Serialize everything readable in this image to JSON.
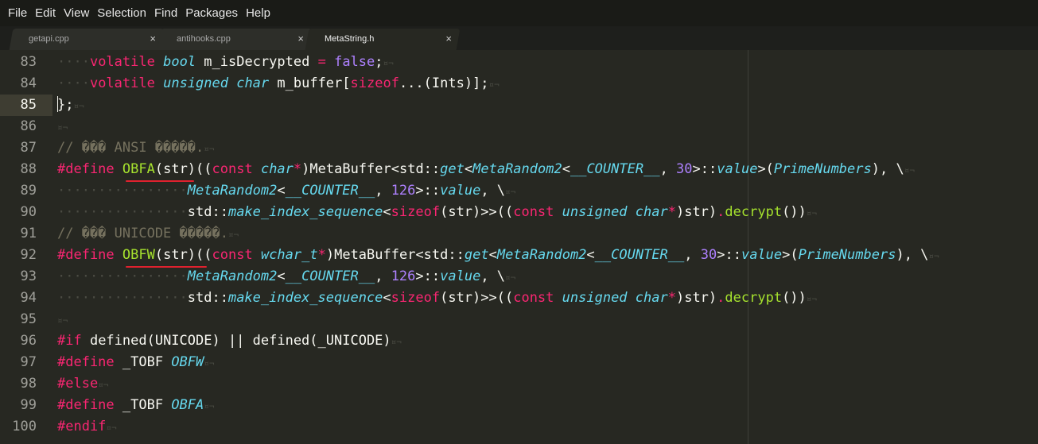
{
  "menu": [
    "File",
    "Edit",
    "View",
    "Selection",
    "Find",
    "Packages",
    "Help"
  ],
  "tabs": [
    {
      "label": "getapi.cpp",
      "close": "×",
      "active": false
    },
    {
      "label": "antihooks.cpp",
      "close": "×",
      "active": false
    },
    {
      "label": "MetaString.h",
      "close": "×",
      "active": true
    }
  ],
  "editor": {
    "lines": [
      {
        "num": "83",
        "tokens": [
          [
            "ws",
            "····"
          ],
          [
            "kw",
            "volatile"
          ],
          [
            "t",
            " "
          ],
          [
            "ty",
            "bool"
          ],
          [
            "t",
            " m_isDecrypted "
          ],
          [
            "kw",
            "="
          ],
          [
            "t",
            " "
          ],
          [
            "nm",
            "false"
          ],
          [
            "t",
            ";"
          ],
          [
            "eol",
            "¤¬"
          ]
        ]
      },
      {
        "num": "84",
        "tokens": [
          [
            "ws",
            "····"
          ],
          [
            "kw",
            "volatile"
          ],
          [
            "t",
            " "
          ],
          [
            "ty",
            "unsigned char"
          ],
          [
            "t",
            " m_buffer["
          ],
          [
            "kw",
            "sizeof"
          ],
          [
            "t",
            "...(Ints)];"
          ],
          [
            "eol",
            "¤¬"
          ]
        ]
      },
      {
        "num": "85",
        "current": true,
        "tokens": [
          [
            "t",
            "};"
          ],
          [
            "eol",
            "¤¬"
          ]
        ]
      },
      {
        "num": "86",
        "tokens": [
          [
            "eol",
            "¤¬"
          ]
        ]
      },
      {
        "num": "87",
        "tokens": [
          [
            "cm",
            "// ��� ANSI �����."
          ],
          [
            "eol",
            "¤¬"
          ]
        ]
      },
      {
        "num": "88",
        "tokens": [
          [
            "kw",
            "#define"
          ],
          [
            "t",
            " "
          ],
          [
            "fn",
            "OBFA"
          ],
          [
            "t",
            "(str)(("
          ],
          [
            "kw",
            "const"
          ],
          [
            "t",
            " "
          ],
          [
            "ty",
            "char"
          ],
          [
            "kw",
            "*"
          ],
          [
            "t",
            ")MetaBuffer<std::"
          ],
          [
            "it",
            "get"
          ],
          [
            "t",
            "<"
          ],
          [
            "it",
            "MetaRandom2"
          ],
          [
            "t",
            "<"
          ],
          [
            "it",
            "__COUNTER__"
          ],
          [
            "t",
            ", "
          ],
          [
            "nm",
            "30"
          ],
          [
            "t",
            ">::"
          ],
          [
            "it",
            "value"
          ],
          [
            "t",
            ">("
          ],
          [
            "it",
            "PrimeNumbers"
          ],
          [
            "t",
            "), \\"
          ],
          [
            "eol",
            "¤¬"
          ]
        ]
      },
      {
        "num": "89",
        "tokens": [
          [
            "ws",
            "················"
          ],
          [
            "it",
            "MetaRandom2"
          ],
          [
            "t",
            "<"
          ],
          [
            "it",
            "__COUNTER__"
          ],
          [
            "t",
            ", "
          ],
          [
            "nm",
            "126"
          ],
          [
            "t",
            ">::"
          ],
          [
            "it",
            "value"
          ],
          [
            "t",
            ", \\"
          ],
          [
            "eol",
            "¤¬"
          ]
        ]
      },
      {
        "num": "90",
        "tokens": [
          [
            "ws",
            "················"
          ],
          [
            "t",
            "std::"
          ],
          [
            "it",
            "make_index_sequence"
          ],
          [
            "t",
            "<"
          ],
          [
            "kw",
            "sizeof"
          ],
          [
            "t",
            "(str)>>(("
          ],
          [
            "kw",
            "const"
          ],
          [
            "t",
            " "
          ],
          [
            "ty",
            "unsigned char"
          ],
          [
            "kw",
            "*"
          ],
          [
            "t",
            ")str)"
          ],
          [
            "kw",
            "."
          ],
          [
            "fn",
            "decrypt"
          ],
          [
            "t",
            "())"
          ],
          [
            "eol",
            "¤¬"
          ]
        ]
      },
      {
        "num": "91",
        "tokens": [
          [
            "cm",
            "// ��� UNICODE �����."
          ],
          [
            "eol",
            "¤¬"
          ]
        ]
      },
      {
        "num": "92",
        "tokens": [
          [
            "kw",
            "#define"
          ],
          [
            "t",
            " "
          ],
          [
            "fn",
            "OBFW"
          ],
          [
            "t",
            "(str)(("
          ],
          [
            "kw",
            "const"
          ],
          [
            "t",
            " "
          ],
          [
            "ty",
            "wchar_t"
          ],
          [
            "kw",
            "*"
          ],
          [
            "t",
            ")MetaBuffer<std::"
          ],
          [
            "it",
            "get"
          ],
          [
            "t",
            "<"
          ],
          [
            "it",
            "MetaRandom2"
          ],
          [
            "t",
            "<"
          ],
          [
            "it",
            "__COUNTER__"
          ],
          [
            "t",
            ", "
          ],
          [
            "nm",
            "30"
          ],
          [
            "t",
            ">::"
          ],
          [
            "it",
            "value"
          ],
          [
            "t",
            ">("
          ],
          [
            "it",
            "PrimeNumbers"
          ],
          [
            "t",
            "), \\"
          ],
          [
            "eol",
            "¤¬"
          ]
        ]
      },
      {
        "num": "93",
        "tokens": [
          [
            "ws",
            "················"
          ],
          [
            "it",
            "MetaRandom2"
          ],
          [
            "t",
            "<"
          ],
          [
            "it",
            "__COUNTER__"
          ],
          [
            "t",
            ", "
          ],
          [
            "nm",
            "126"
          ],
          [
            "t",
            ">::"
          ],
          [
            "it",
            "value"
          ],
          [
            "t",
            ", \\"
          ],
          [
            "eol",
            "¤¬"
          ]
        ]
      },
      {
        "num": "94",
        "tokens": [
          [
            "ws",
            "················"
          ],
          [
            "t",
            "std::"
          ],
          [
            "it",
            "make_index_sequence"
          ],
          [
            "t",
            "<"
          ],
          [
            "kw",
            "sizeof"
          ],
          [
            "t",
            "(str)>>(("
          ],
          [
            "kw",
            "const"
          ],
          [
            "t",
            " "
          ],
          [
            "ty",
            "unsigned char"
          ],
          [
            "kw",
            "*"
          ],
          [
            "t",
            ")str)"
          ],
          [
            "kw",
            "."
          ],
          [
            "fn",
            "decrypt"
          ],
          [
            "t",
            "())"
          ],
          [
            "eol",
            "¤¬"
          ]
        ]
      },
      {
        "num": "95",
        "tokens": [
          [
            "eol",
            "¤¬"
          ]
        ]
      },
      {
        "num": "96",
        "tokens": [
          [
            "kw",
            "#if"
          ],
          [
            "t",
            " defined(UNICODE) || defined(_UNICODE)"
          ],
          [
            "eol",
            "¤¬"
          ]
        ]
      },
      {
        "num": "97",
        "tokens": [
          [
            "kw",
            "#define"
          ],
          [
            "t",
            " _TOBF "
          ],
          [
            "it",
            "OBFW"
          ],
          [
            "eol",
            "¤¬"
          ]
        ]
      },
      {
        "num": "98",
        "tokens": [
          [
            "kw",
            "#else"
          ],
          [
            "eol",
            "¤¬"
          ]
        ]
      },
      {
        "num": "99",
        "tokens": [
          [
            "kw",
            "#define"
          ],
          [
            "t",
            " _TOBF "
          ],
          [
            "it",
            "OBFA"
          ],
          [
            "eol",
            "¤¬"
          ]
        ]
      },
      {
        "num": "100",
        "tokens": [
          [
            "kw",
            "#endif"
          ],
          [
            "eol",
            "¤¬"
          ]
        ]
      }
    ]
  }
}
